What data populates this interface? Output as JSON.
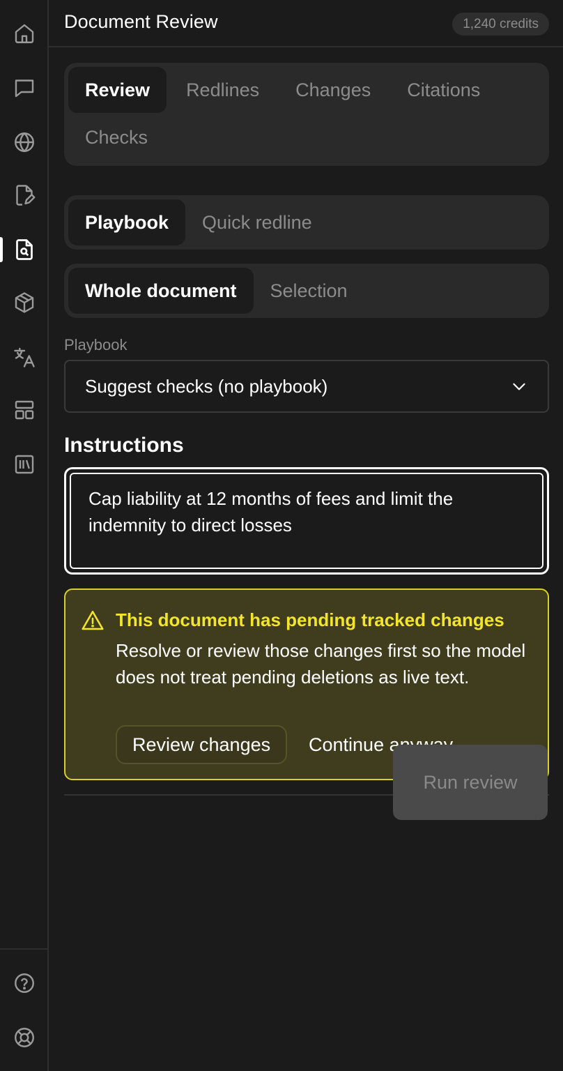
{
  "header": {
    "title": "Document Review",
    "credits": "1,240 credits"
  },
  "sidebar": {
    "items": [
      {
        "icon": "home-icon"
      },
      {
        "icon": "chat-icon"
      },
      {
        "icon": "globe-icon"
      },
      {
        "icon": "file-edit-icon"
      },
      {
        "icon": "file-search-icon",
        "active": true
      },
      {
        "icon": "cube-icon"
      },
      {
        "icon": "translate-icon"
      },
      {
        "icon": "layout-icon"
      },
      {
        "icon": "library-icon"
      }
    ],
    "footer": [
      {
        "icon": "help-icon"
      },
      {
        "icon": "lifebuoy-icon"
      }
    ]
  },
  "tabs": [
    "Review",
    "Redlines",
    "Changes",
    "Citations",
    "Checks"
  ],
  "mode_toggle": [
    "Playbook",
    "Quick redline"
  ],
  "scope_toggle": [
    "Whole document",
    "Selection"
  ],
  "playbook": {
    "label": "Playbook",
    "value": "Suggest checks (no playbook)"
  },
  "instructions": {
    "title": "Instructions",
    "value": "Cap liability at 12 months of fees and limit the indemnity to direct losses"
  },
  "alert": {
    "title": "This document has pending tracked changes",
    "body": "Resolve or review those changes first so the model does not treat pending deletions as live text.",
    "primary_label": "Review changes",
    "secondary_label": "Continue anyway",
    "border_color": "#d9d02a",
    "title_color": "#f2e52b"
  },
  "run_button": "Run review"
}
